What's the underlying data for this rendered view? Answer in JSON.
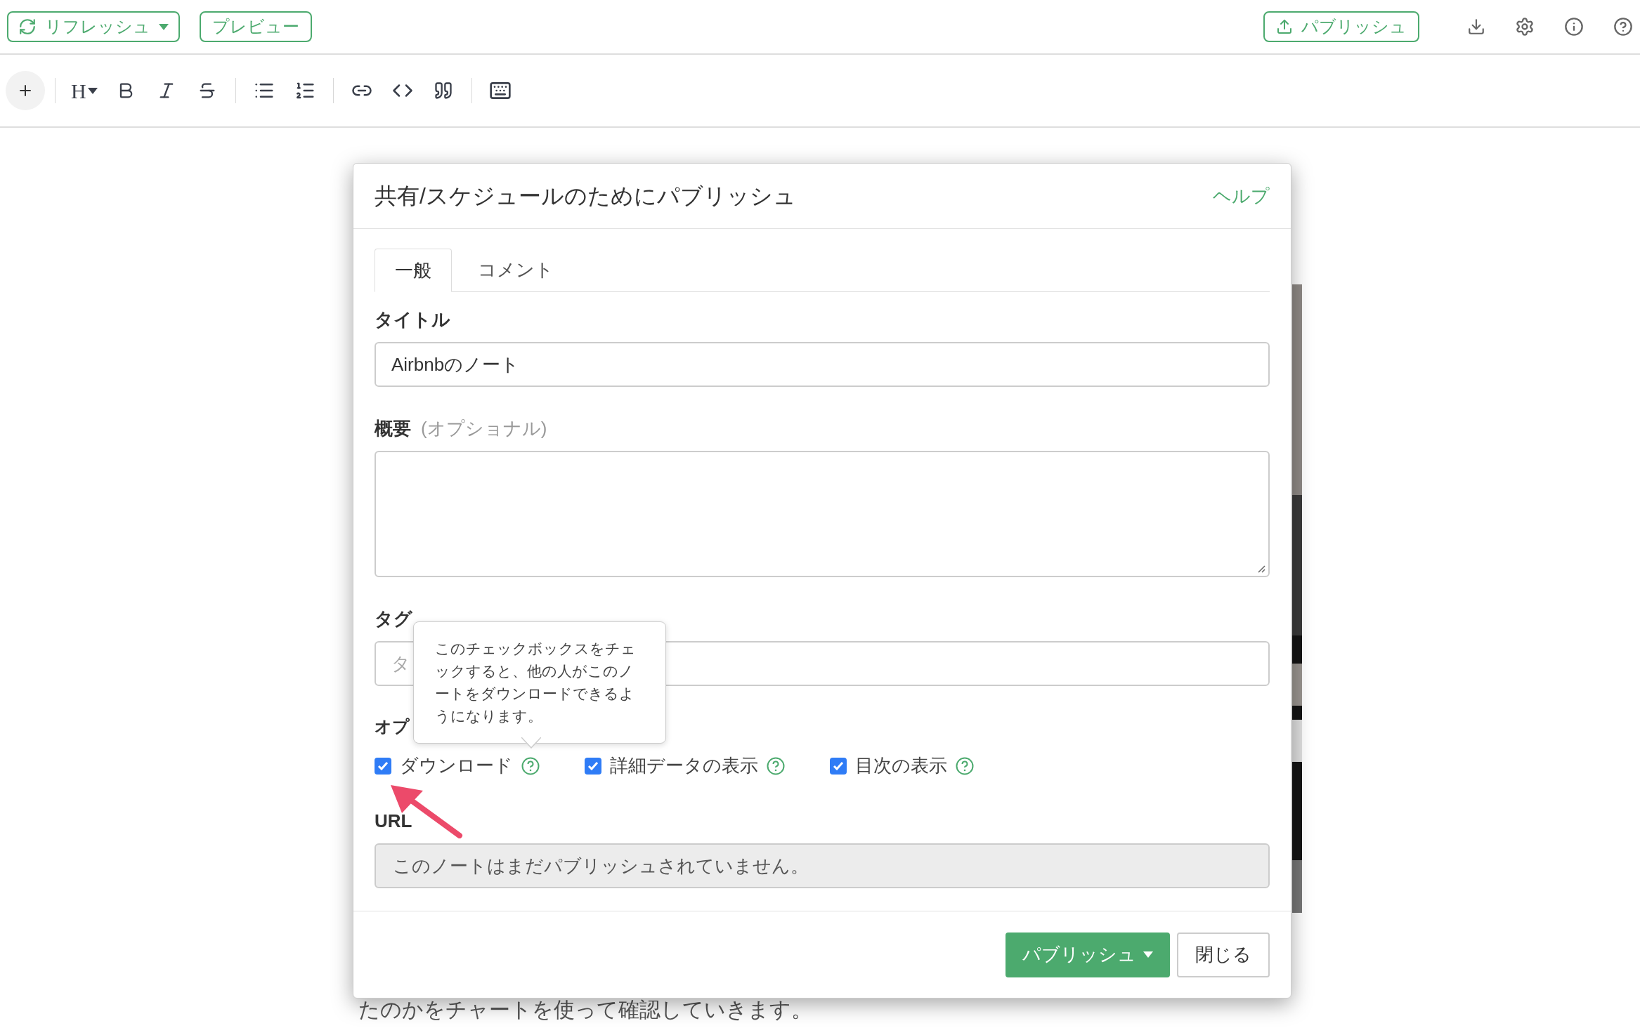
{
  "top_bar": {
    "refresh_button": "リフレッシュ",
    "preview_button": "プレビュー",
    "publish_button": "パブリッシュ"
  },
  "editor_toolbar": {
    "heading_button": "H"
  },
  "background_text": "たのかをチャートを使って確認していきます。",
  "dialog": {
    "title": "共有/スケジュールのためにパブリッシュ",
    "help_link": "ヘルプ",
    "tabs": [
      {
        "label": "一般",
        "selected": true
      },
      {
        "label": "コメント",
        "selected": false
      }
    ],
    "title_label": "タイトル",
    "title_value": "Airbnbのノート",
    "summary_label": "概要",
    "summary_hint": "(オプショナル)",
    "tags_label": "タグ",
    "tags_placeholder": "タ",
    "options_label": "オプ",
    "options": [
      {
        "label": "ダウンロード",
        "checked": true
      },
      {
        "label": "詳細データの表示",
        "checked": true
      },
      {
        "label": "目次の表示",
        "checked": true
      }
    ],
    "tooltip": "このチェックボックスをチェックすると、他の人がこのノートをダウンロードできるようになります。",
    "url_label": "URL",
    "url_value": "このノートはまだパブリッシュされていません。",
    "publish_button": "パブリッシュ",
    "close_button": "閉じる"
  }
}
